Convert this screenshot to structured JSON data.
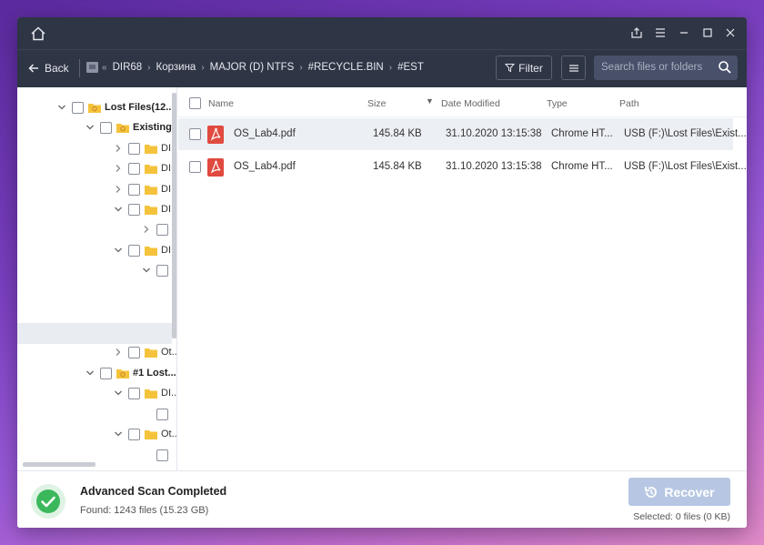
{
  "titlebar": {
    "icons": [
      "home-icon",
      "share-icon",
      "menu-icon",
      "minimize-icon",
      "maximize-icon",
      "close-icon"
    ]
  },
  "nav": {
    "back_label": "Back",
    "breadcrumbs": [
      "DIR68",
      "Корзина",
      "MAJOR (D) NTFS",
      "#RECYCLE.BIN",
      "#EST"
    ],
    "filter_label": "Filter",
    "search_placeholder": "Search files or folders"
  },
  "tree": {
    "root_label": "Lost Files(12...",
    "existing_label": "Existing...",
    "dir_label": "DI...",
    "other_label": "Ot...",
    "lost1_label": "#1 Lost..."
  },
  "list": {
    "headers": {
      "name": "Name",
      "size": "Size",
      "date": "Date Modified",
      "type": "Type",
      "path": "Path"
    },
    "rows": [
      {
        "name": "OS_Lab4.pdf",
        "size": "145.84 KB",
        "date": "31.10.2020 13:15:38",
        "type": "Chrome HT...",
        "path": "USB (F:)\\Lost Files\\Exist..."
      },
      {
        "name": "OS_Lab4.pdf",
        "size": "145.84 KB",
        "date": "31.10.2020 13:15:38",
        "type": "Chrome HT...",
        "path": "USB (F:)\\Lost Files\\Exist..."
      }
    ]
  },
  "footer": {
    "status_title": "Advanced Scan Completed",
    "status_sub": "Found: 1243 files (15.23 GB)",
    "recover_label": "Recover",
    "selected": "Selected: 0 files (0 KB)"
  },
  "colors": {
    "titlebar": "#2e3545",
    "accent_folder": "#f5c33b",
    "pdf_red": "#e04a3f",
    "ok_green": "#3cb85c",
    "recover_disabled": "#b7c7e3"
  }
}
